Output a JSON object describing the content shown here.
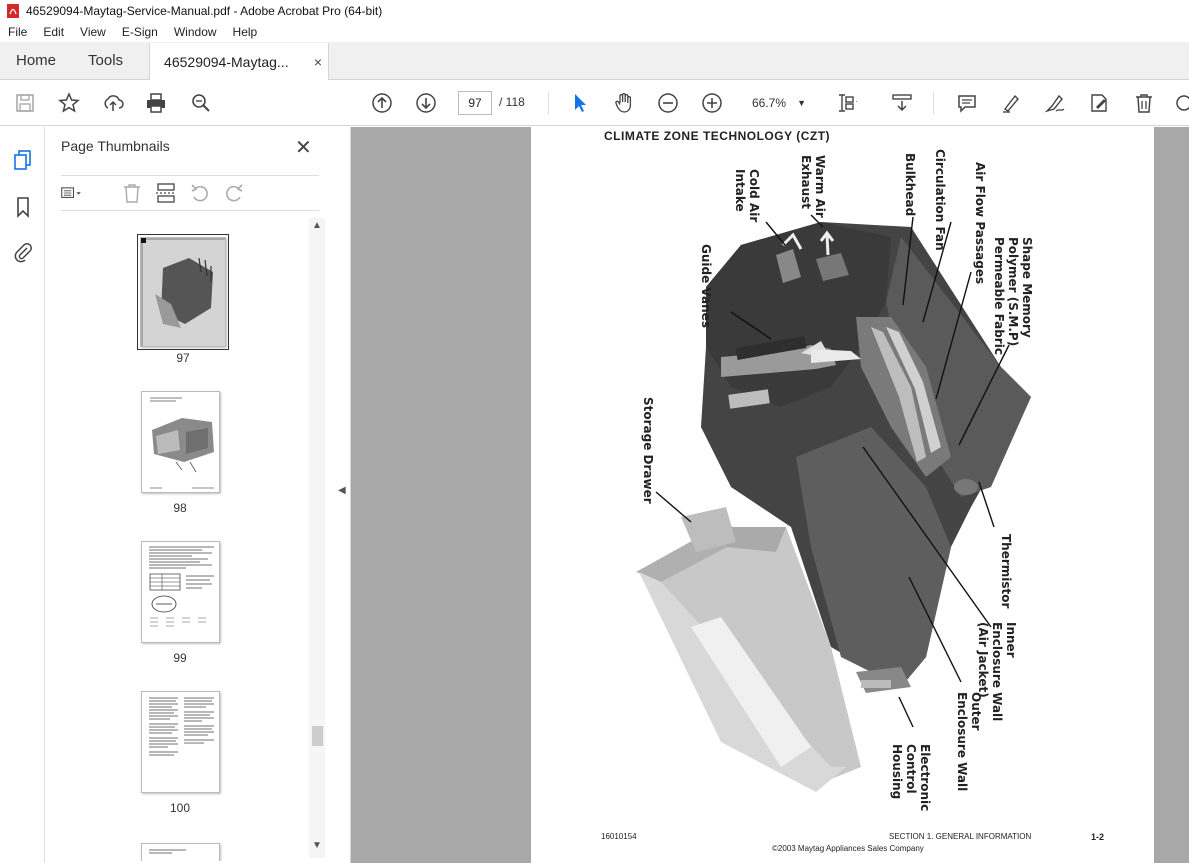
{
  "window": {
    "title": "46529094-Maytag-Service-Manual.pdf - Adobe Acrobat Pro (64-bit)"
  },
  "menu": [
    "File",
    "Edit",
    "View",
    "E-Sign",
    "Window",
    "Help"
  ],
  "tabs": {
    "home": "Home",
    "tools": "Tools",
    "document": "46529094-Maytag...",
    "close": "×"
  },
  "toolbar": {
    "current_page": "97",
    "page_total": "/ 118",
    "zoom": "66.7%",
    "icons": [
      "save-icon",
      "star-icon",
      "upload-icon",
      "print-icon",
      "zoom-search-icon",
      "prev-page-icon",
      "next-page-icon",
      "select-cursor-icon",
      "hand-icon",
      "zoom-out-icon",
      "zoom-in-icon",
      "fit-page-icon",
      "scroll-mode-icon",
      "comment-icon",
      "highlight-icon",
      "sign-icon",
      "edit-icon",
      "delete-icon"
    ]
  },
  "panel": {
    "title": "Page Thumbnails",
    "close": "✕",
    "thumbnails": [
      {
        "label": "97",
        "selected": true
      },
      {
        "label": "98",
        "selected": false
      },
      {
        "label": "99",
        "selected": false
      },
      {
        "label": "100",
        "selected": false
      }
    ]
  },
  "colors": {
    "accent": "#1473e6",
    "doc_background": "#a8a8a8",
    "pdf_icon": "#d4282a"
  },
  "page": {
    "title": "CLIMATE ZONE TECHNOLOGY (CZT)",
    "callouts": {
      "cold_air_intake": "Cold Air\nIntake",
      "warm_air_exhaust": "Warm Air\nExhaust",
      "bulkhead": "Bulkhead",
      "circulation_fan": "Circulation Fan",
      "air_flow_passages": "Air Flow Passages",
      "shape_memory": "Shape Memory\nPolymer (S.M.P)\nPermeable Fabric",
      "guide_vanes": "Guide Vanes",
      "storage_drawer": "Storage Drawer",
      "thermistor": "Thermistor",
      "inner_enclosure": "Inner\nEnclosure Wall\n(Air Jacket)",
      "outer_enclosure": "Outer\nEnclosure Wall",
      "electronic_control": "Electronic\nControl\nHousing"
    },
    "footer": {
      "doc_number": "16010154",
      "section": "SECTION 1.   GENERAL INFORMATION",
      "copyright": "©2003  Maytag Appliances Sales Company",
      "page_number": "1-2"
    }
  }
}
